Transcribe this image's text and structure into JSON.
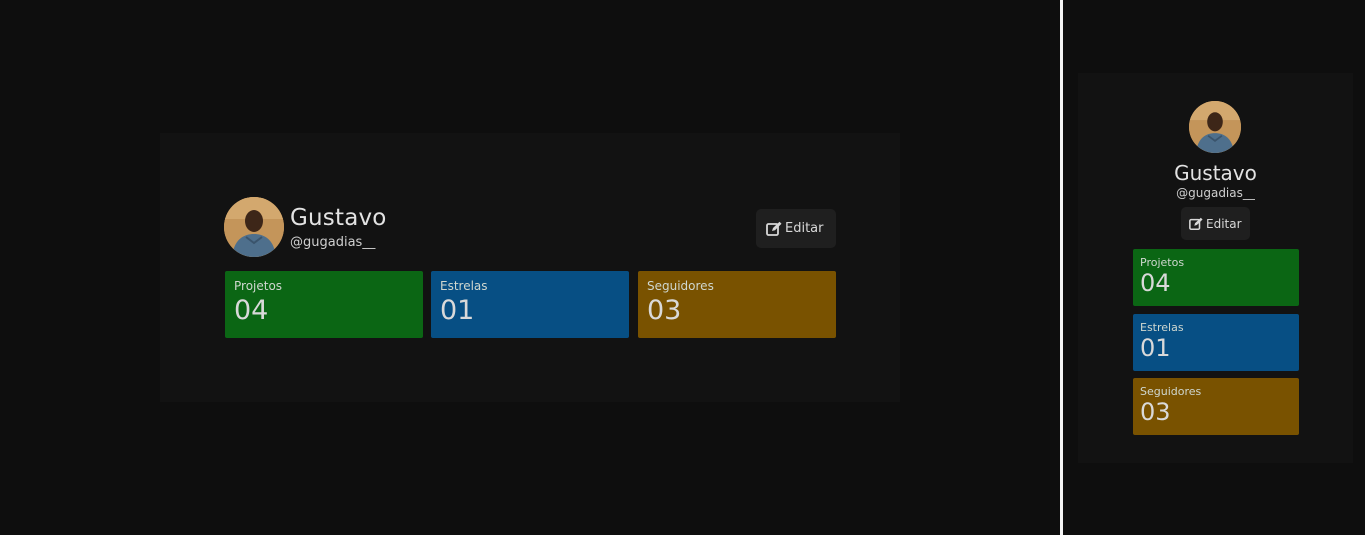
{
  "profile": {
    "name": "Gustavo",
    "handle": "@gugadias__",
    "edit_label": "Editar"
  },
  "stats": [
    {
      "label": "Projetos",
      "value": "04",
      "color": "#0b6614"
    },
    {
      "label": "Estrelas",
      "value": "01",
      "color": "#074f84"
    },
    {
      "label": "Seguidores",
      "value": "03",
      "color": "#795200"
    }
  ],
  "icons": {
    "edit": "edit-icon",
    "avatar": "avatar-photo"
  },
  "colors": {
    "background": "#0e0e0e",
    "card": "#121212",
    "button": "#1f1f1f"
  }
}
